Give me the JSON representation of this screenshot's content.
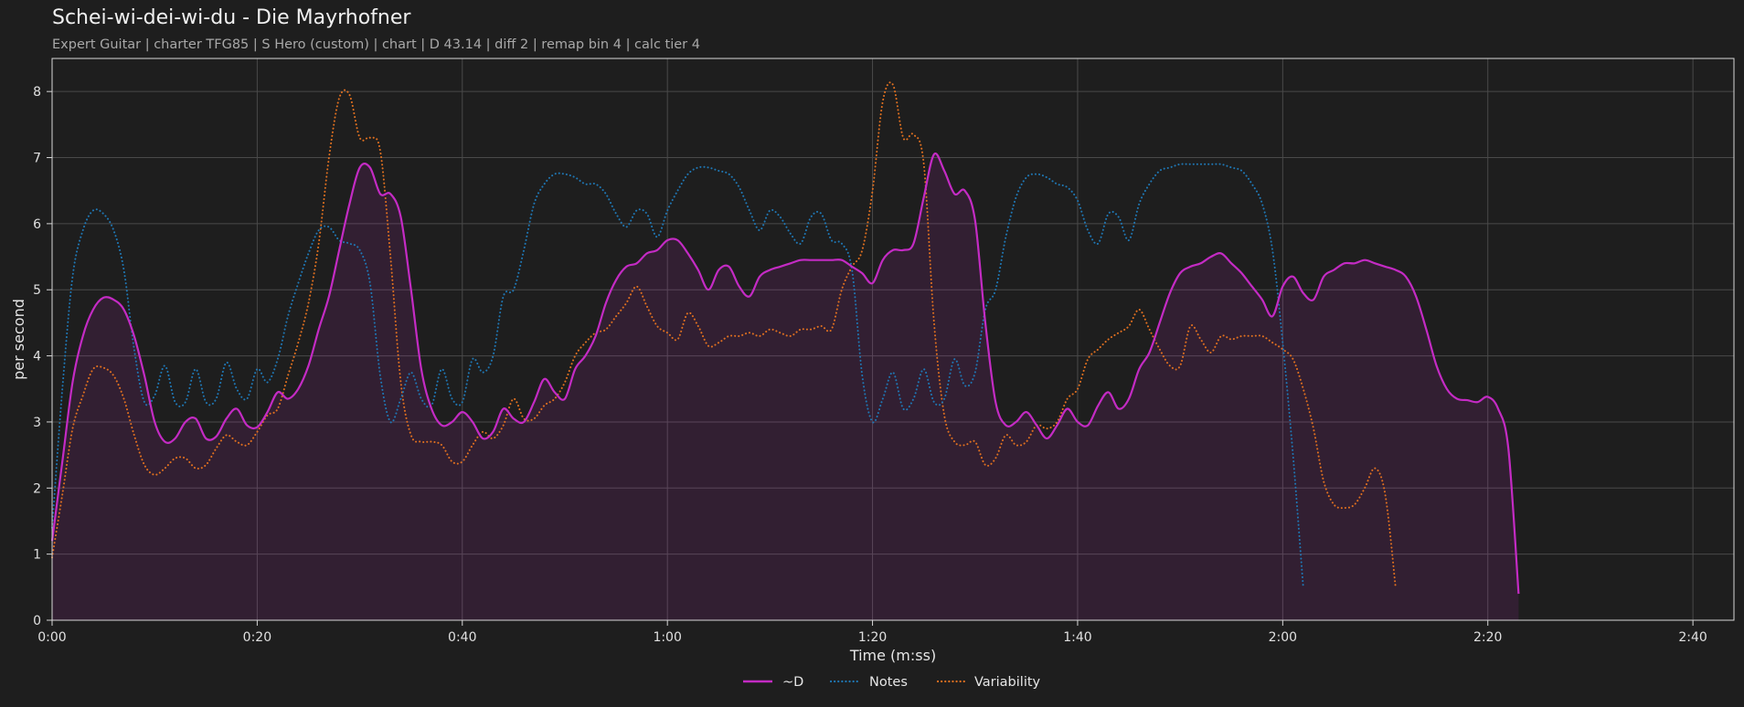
{
  "chart_data": {
    "type": "line",
    "title": "Schei-wi-dei-wi-du - Die Mayrhofner",
    "subtitle": "Expert Guitar  |  charter TFG85  |  S Hero (custom)  |  chart  |  D 43.14  |  diff 2  |  remap bin 4  |  calc tier 4",
    "xlabel": "Time (m:ss)",
    "ylabel": "per second",
    "xlim": [
      0,
      164
    ],
    "ylim": [
      0,
      8.5
    ],
    "x_ticks": [
      0,
      20,
      40,
      60,
      80,
      100,
      120,
      140,
      160
    ],
    "x_tick_labels": [
      "0:00",
      "0:20",
      "0:40",
      "1:00",
      "1:20",
      "1:40",
      "2:00",
      "2:20",
      "2:40"
    ],
    "y_ticks": [
      0,
      1,
      2,
      3,
      4,
      5,
      6,
      7,
      8
    ],
    "y_tick_labels": [
      "0",
      "1",
      "2",
      "3",
      "4",
      "5",
      "6",
      "7",
      "8"
    ],
    "grid": true,
    "legend_position": "bottom-center",
    "x": [
      0,
      1,
      2,
      3,
      4,
      5,
      6,
      7,
      8,
      9,
      10,
      11,
      12,
      13,
      14,
      15,
      16,
      17,
      18,
      19,
      20,
      21,
      22,
      23,
      24,
      25,
      26,
      27,
      28,
      29,
      30,
      31,
      32,
      33,
      34,
      35,
      36,
      37,
      38,
      39,
      40,
      41,
      42,
      43,
      44,
      45,
      46,
      47,
      48,
      49,
      50,
      51,
      52,
      53,
      54,
      55,
      56,
      57,
      58,
      59,
      60,
      61,
      62,
      63,
      64,
      65,
      66,
      67,
      68,
      69,
      70,
      71,
      72,
      73,
      74,
      75,
      76,
      77,
      78,
      79,
      80,
      81,
      82,
      83,
      84,
      85,
      86,
      87,
      88,
      89,
      90,
      91,
      92,
      93,
      94,
      95,
      96,
      97,
      98,
      99,
      100,
      101,
      102,
      103,
      104,
      105,
      106,
      107,
      108,
      109,
      110,
      111,
      112,
      113,
      114,
      115,
      116,
      117,
      118,
      119,
      120,
      121,
      122,
      123,
      124,
      125,
      126,
      127,
      128,
      129,
      130,
      131,
      132,
      133,
      134,
      135,
      136,
      137,
      138,
      139,
      140,
      141,
      142,
      143,
      144,
      145,
      146,
      147,
      148,
      149,
      150,
      151,
      152,
      153,
      154,
      155,
      156,
      157,
      158,
      159,
      160,
      161,
      162,
      163,
      164
    ],
    "series": [
      {
        "name": "~D",
        "color": "#c42bc4",
        "style": "solid",
        "filled": true,
        "values": [
          1.2,
          2.4,
          3.6,
          4.3,
          4.7,
          4.88,
          4.85,
          4.7,
          4.3,
          3.7,
          3.0,
          2.7,
          2.75,
          3.0,
          3.05,
          2.75,
          2.78,
          3.05,
          3.2,
          2.95,
          2.92,
          3.15,
          3.45,
          3.35,
          3.5,
          3.85,
          4.4,
          4.9,
          5.6,
          6.3,
          6.85,
          6.85,
          6.45,
          6.45,
          6.1,
          5.0,
          3.8,
          3.2,
          2.95,
          3.0,
          3.15,
          3.0,
          2.75,
          2.85,
          3.2,
          3.05,
          3.0,
          3.3,
          3.65,
          3.45,
          3.35,
          3.8,
          4.0,
          4.3,
          4.8,
          5.15,
          5.35,
          5.4,
          5.55,
          5.6,
          5.75,
          5.75,
          5.55,
          5.3,
          5.0,
          5.3,
          5.35,
          5.05,
          4.9,
          5.2,
          5.3,
          5.35,
          5.4,
          5.45,
          5.45,
          5.45,
          5.45,
          5.45,
          5.35,
          5.25,
          5.1,
          5.45,
          5.6,
          5.6,
          5.7,
          6.4,
          7.05,
          6.8,
          6.45,
          6.5,
          6.05,
          4.5,
          3.3,
          2.95,
          3.0,
          3.15,
          2.95,
          2.75,
          2.95,
          3.2,
          3.0,
          2.95,
          3.25,
          3.45,
          3.2,
          3.35,
          3.8,
          4.05,
          4.5,
          4.95,
          5.25,
          5.35,
          5.4,
          5.5,
          5.55,
          5.4,
          5.25,
          5.05,
          4.85,
          4.6,
          5.05,
          5.2,
          4.95,
          4.85,
          5.2,
          5.3,
          5.4,
          5.4,
          5.45,
          5.4,
          5.35,
          5.3,
          5.2,
          4.9,
          4.4,
          3.85,
          3.5,
          3.35,
          3.33,
          3.3,
          3.38,
          3.2,
          2.6,
          0.4
        ]
      },
      {
        "name": "Notes",
        "color": "#1f77b4",
        "style": "dotted",
        "filled": false,
        "values": [
          1.4,
          3.5,
          5.2,
          5.9,
          6.2,
          6.15,
          5.9,
          5.3,
          4.1,
          3.3,
          3.4,
          3.85,
          3.3,
          3.3,
          3.8,
          3.3,
          3.35,
          3.9,
          3.5,
          3.35,
          3.8,
          3.6,
          3.95,
          4.6,
          5.1,
          5.55,
          5.9,
          5.95,
          5.75,
          5.7,
          5.6,
          5.1,
          3.7,
          3.0,
          3.35,
          3.75,
          3.35,
          3.25,
          3.8,
          3.35,
          3.3,
          3.95,
          3.75,
          4.0,
          4.9,
          5.0,
          5.6,
          6.3,
          6.6,
          6.75,
          6.75,
          6.7,
          6.6,
          6.6,
          6.45,
          6.15,
          5.95,
          6.2,
          6.15,
          5.8,
          6.2,
          6.5,
          6.75,
          6.85,
          6.85,
          6.8,
          6.75,
          6.55,
          6.2,
          5.9,
          6.2,
          6.1,
          5.85,
          5.7,
          6.1,
          6.15,
          5.75,
          5.7,
          5.3,
          3.7,
          3.0,
          3.35,
          3.75,
          3.2,
          3.35,
          3.8,
          3.3,
          3.35,
          3.95,
          3.55,
          3.75,
          4.7,
          5.0,
          5.8,
          6.4,
          6.7,
          6.75,
          6.7,
          6.6,
          6.55,
          6.35,
          5.9,
          5.7,
          6.15,
          6.1,
          5.75,
          6.3,
          6.6,
          6.8,
          6.85,
          6.9,
          6.9,
          6.9,
          6.9,
          6.9,
          6.85,
          6.8,
          6.6,
          6.3,
          5.6,
          4.2,
          2.5,
          0.5
        ]
      },
      {
        "name": "Variability",
        "color": "#e07020",
        "style": "dotted",
        "filled": false,
        "values": [
          0.95,
          1.9,
          2.9,
          3.4,
          3.8,
          3.82,
          3.7,
          3.35,
          2.8,
          2.35,
          2.2,
          2.3,
          2.45,
          2.45,
          2.3,
          2.35,
          2.6,
          2.8,
          2.7,
          2.65,
          2.85,
          3.1,
          3.2,
          3.7,
          4.2,
          4.8,
          5.7,
          7.0,
          7.9,
          7.95,
          7.3,
          7.3,
          7.1,
          5.5,
          3.6,
          2.8,
          2.7,
          2.7,
          2.65,
          2.4,
          2.4,
          2.65,
          2.85,
          2.75,
          2.95,
          3.35,
          3.05,
          3.05,
          3.25,
          3.35,
          3.6,
          4.0,
          4.2,
          4.35,
          4.4,
          4.6,
          4.8,
          5.05,
          4.75,
          4.45,
          4.35,
          4.25,
          4.65,
          4.45,
          4.15,
          4.2,
          4.3,
          4.3,
          4.35,
          4.3,
          4.4,
          4.35,
          4.3,
          4.4,
          4.4,
          4.45,
          4.4,
          5.0,
          5.35,
          5.6,
          6.5,
          7.85,
          8.1,
          7.3,
          7.35,
          6.9,
          4.5,
          3.1,
          2.7,
          2.65,
          2.7,
          2.35,
          2.45,
          2.8,
          2.65,
          2.7,
          2.95,
          2.9,
          3.0,
          3.35,
          3.5,
          3.95,
          4.1,
          4.25,
          4.35,
          4.45,
          4.7,
          4.4,
          4.1,
          3.85,
          3.85,
          4.45,
          4.25,
          4.05,
          4.3,
          4.25,
          4.3,
          4.3,
          4.3,
          4.2,
          4.1,
          3.95,
          3.5,
          2.9,
          2.1,
          1.75,
          1.7,
          1.75,
          2.0,
          2.3,
          1.9,
          0.5
        ]
      }
    ]
  }
}
